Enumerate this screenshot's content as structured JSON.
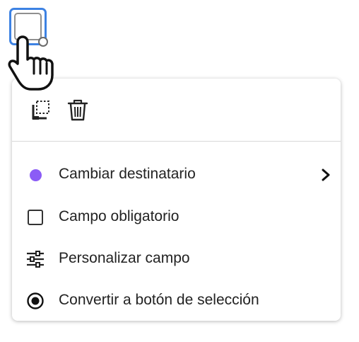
{
  "colors": {
    "selection_border": "#3d82e3",
    "recipient_dot": "#8b5cf6",
    "icon": "#222222"
  },
  "form_field": {
    "type": "checkbox",
    "selected": true
  },
  "cursor": {
    "icon": "hand-pointer-icon"
  },
  "context_menu": {
    "toolbar": [
      {
        "icon": "duplicate-icon",
        "action": "duplicate"
      },
      {
        "icon": "trash-icon",
        "action": "delete"
      }
    ],
    "items": [
      {
        "icon": "recipient-color-dot-icon",
        "label": "Cambiar destinatario",
        "has_submenu": true
      },
      {
        "icon": "checkbox-icon",
        "label": "Campo obligatorio",
        "checked": false
      },
      {
        "icon": "sliders-icon",
        "label": "Personalizar campo"
      },
      {
        "icon": "radio-button-icon",
        "label": "Convertir a botón de selección"
      }
    ]
  }
}
